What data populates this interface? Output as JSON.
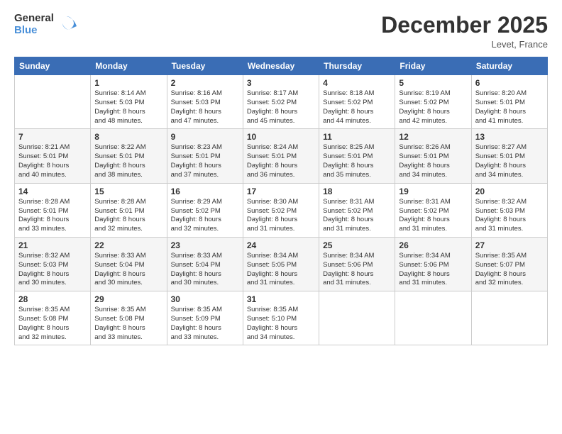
{
  "header": {
    "logo_general": "General",
    "logo_blue": "Blue",
    "title": "December 2025",
    "location": "Levet, France"
  },
  "columns": [
    "Sunday",
    "Monday",
    "Tuesday",
    "Wednesday",
    "Thursday",
    "Friday",
    "Saturday"
  ],
  "weeks": [
    [
      {
        "day": "",
        "info": ""
      },
      {
        "day": "1",
        "info": "Sunrise: 8:14 AM\nSunset: 5:03 PM\nDaylight: 8 hours\nand 48 minutes."
      },
      {
        "day": "2",
        "info": "Sunrise: 8:16 AM\nSunset: 5:03 PM\nDaylight: 8 hours\nand 47 minutes."
      },
      {
        "day": "3",
        "info": "Sunrise: 8:17 AM\nSunset: 5:02 PM\nDaylight: 8 hours\nand 45 minutes."
      },
      {
        "day": "4",
        "info": "Sunrise: 8:18 AM\nSunset: 5:02 PM\nDaylight: 8 hours\nand 44 minutes."
      },
      {
        "day": "5",
        "info": "Sunrise: 8:19 AM\nSunset: 5:02 PM\nDaylight: 8 hours\nand 42 minutes."
      },
      {
        "day": "6",
        "info": "Sunrise: 8:20 AM\nSunset: 5:01 PM\nDaylight: 8 hours\nand 41 minutes."
      }
    ],
    [
      {
        "day": "7",
        "info": "Sunrise: 8:21 AM\nSunset: 5:01 PM\nDaylight: 8 hours\nand 40 minutes."
      },
      {
        "day": "8",
        "info": "Sunrise: 8:22 AM\nSunset: 5:01 PM\nDaylight: 8 hours\nand 38 minutes."
      },
      {
        "day": "9",
        "info": "Sunrise: 8:23 AM\nSunset: 5:01 PM\nDaylight: 8 hours\nand 37 minutes."
      },
      {
        "day": "10",
        "info": "Sunrise: 8:24 AM\nSunset: 5:01 PM\nDaylight: 8 hours\nand 36 minutes."
      },
      {
        "day": "11",
        "info": "Sunrise: 8:25 AM\nSunset: 5:01 PM\nDaylight: 8 hours\nand 35 minutes."
      },
      {
        "day": "12",
        "info": "Sunrise: 8:26 AM\nSunset: 5:01 PM\nDaylight: 8 hours\nand 34 minutes."
      },
      {
        "day": "13",
        "info": "Sunrise: 8:27 AM\nSunset: 5:01 PM\nDaylight: 8 hours\nand 34 minutes."
      }
    ],
    [
      {
        "day": "14",
        "info": "Sunrise: 8:28 AM\nSunset: 5:01 PM\nDaylight: 8 hours\nand 33 minutes."
      },
      {
        "day": "15",
        "info": "Sunrise: 8:28 AM\nSunset: 5:01 PM\nDaylight: 8 hours\nand 32 minutes."
      },
      {
        "day": "16",
        "info": "Sunrise: 8:29 AM\nSunset: 5:02 PM\nDaylight: 8 hours\nand 32 minutes."
      },
      {
        "day": "17",
        "info": "Sunrise: 8:30 AM\nSunset: 5:02 PM\nDaylight: 8 hours\nand 31 minutes."
      },
      {
        "day": "18",
        "info": "Sunrise: 8:31 AM\nSunset: 5:02 PM\nDaylight: 8 hours\nand 31 minutes."
      },
      {
        "day": "19",
        "info": "Sunrise: 8:31 AM\nSunset: 5:02 PM\nDaylight: 8 hours\nand 31 minutes."
      },
      {
        "day": "20",
        "info": "Sunrise: 8:32 AM\nSunset: 5:03 PM\nDaylight: 8 hours\nand 31 minutes."
      }
    ],
    [
      {
        "day": "21",
        "info": "Sunrise: 8:32 AM\nSunset: 5:03 PM\nDaylight: 8 hours\nand 30 minutes."
      },
      {
        "day": "22",
        "info": "Sunrise: 8:33 AM\nSunset: 5:04 PM\nDaylight: 8 hours\nand 30 minutes."
      },
      {
        "day": "23",
        "info": "Sunrise: 8:33 AM\nSunset: 5:04 PM\nDaylight: 8 hours\nand 30 minutes."
      },
      {
        "day": "24",
        "info": "Sunrise: 8:34 AM\nSunset: 5:05 PM\nDaylight: 8 hours\nand 31 minutes."
      },
      {
        "day": "25",
        "info": "Sunrise: 8:34 AM\nSunset: 5:06 PM\nDaylight: 8 hours\nand 31 minutes."
      },
      {
        "day": "26",
        "info": "Sunrise: 8:34 AM\nSunset: 5:06 PM\nDaylight: 8 hours\nand 31 minutes."
      },
      {
        "day": "27",
        "info": "Sunrise: 8:35 AM\nSunset: 5:07 PM\nDaylight: 8 hours\nand 32 minutes."
      }
    ],
    [
      {
        "day": "28",
        "info": "Sunrise: 8:35 AM\nSunset: 5:08 PM\nDaylight: 8 hours\nand 32 minutes."
      },
      {
        "day": "29",
        "info": "Sunrise: 8:35 AM\nSunset: 5:08 PM\nDaylight: 8 hours\nand 33 minutes."
      },
      {
        "day": "30",
        "info": "Sunrise: 8:35 AM\nSunset: 5:09 PM\nDaylight: 8 hours\nand 33 minutes."
      },
      {
        "day": "31",
        "info": "Sunrise: 8:35 AM\nSunset: 5:10 PM\nDaylight: 8 hours\nand 34 minutes."
      },
      {
        "day": "",
        "info": ""
      },
      {
        "day": "",
        "info": ""
      },
      {
        "day": "",
        "info": ""
      }
    ]
  ]
}
